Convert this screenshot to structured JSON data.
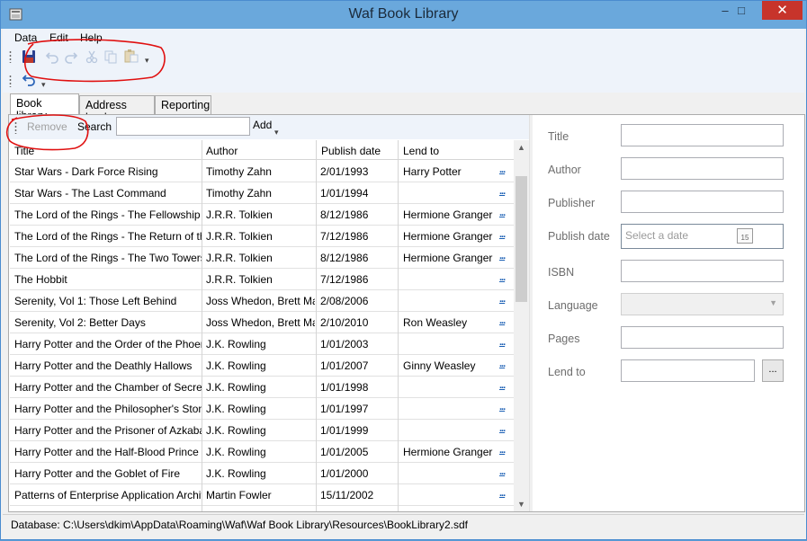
{
  "window": {
    "title": "Waf Book Library",
    "minimize": "–",
    "maximize": "□",
    "close": "✕"
  },
  "menu": [
    "Data",
    "Edit",
    "Help"
  ],
  "toolbar": {
    "icons": [
      "save-icon",
      "undo-icon",
      "redo-icon",
      "cut-icon",
      "copy-icon",
      "paste-icon"
    ],
    "overflow": "▾",
    "undo_overflow": "▾"
  },
  "tabs": [
    "Book library",
    "Address book",
    "Reporting"
  ],
  "list_toolbar": {
    "remove": "Remove",
    "search": "Search",
    "search_value": "",
    "add": "Add",
    "overflow": "▾"
  },
  "grid": {
    "columns": [
      "Title",
      "Author",
      "Publish date",
      "Lend to"
    ],
    "rows": [
      [
        "Star Wars - Dark Force Rising",
        "Timothy Zahn",
        "2/01/1993",
        "Harry Potter"
      ],
      [
        "Star Wars - The Last Command",
        "Timothy Zahn",
        "1/01/1994",
        ""
      ],
      [
        "The Lord of the Rings - The Fellowship",
        "J.R.R. Tolkien",
        "8/12/1986",
        "Hermione Granger"
      ],
      [
        "The Lord of the Rings - The Return of the King",
        "J.R.R. Tolkien",
        "7/12/1986",
        "Hermione Granger"
      ],
      [
        "The Lord of the Rings - The Two Towers",
        "J.R.R. Tolkien",
        "8/12/1986",
        "Hermione Granger"
      ],
      [
        "The Hobbit",
        "J.R.R. Tolkien",
        "7/12/1986",
        ""
      ],
      [
        "Serenity, Vol 1: Those Left Behind",
        "Joss Whedon, Brett Matthews",
        "2/08/2006",
        ""
      ],
      [
        "Serenity, Vol 2: Better Days",
        "Joss Whedon, Brett Matthews",
        "2/10/2010",
        "Ron Weasley"
      ],
      [
        "Harry Potter and the Order of the Phoenix",
        "J.K. Rowling",
        "1/01/2003",
        ""
      ],
      [
        "Harry Potter and the Deathly Hallows",
        "J.K. Rowling",
        "1/01/2007",
        "Ginny Weasley"
      ],
      [
        "Harry Potter and the Chamber of Secrets",
        "J.K. Rowling",
        "1/01/1998",
        ""
      ],
      [
        "Harry Potter and the Philosopher's Stone",
        "J.K. Rowling",
        "1/01/1997",
        ""
      ],
      [
        "Harry Potter and the Prisoner of Azkaban",
        "J.K. Rowling",
        "1/01/1999",
        ""
      ],
      [
        "Harry Potter and the Half-Blood Prince",
        "J.K. Rowling",
        "1/01/2005",
        "Hermione Granger"
      ],
      [
        "Harry Potter and the Goblet of Fire",
        "J.K. Rowling",
        "1/01/2000",
        ""
      ],
      [
        "Patterns of Enterprise Application Architecture",
        "Martin Fowler",
        "15/11/2002",
        ""
      ]
    ],
    "lend_button": "..."
  },
  "details": {
    "fields": [
      {
        "label": "Title",
        "value": ""
      },
      {
        "label": "Author",
        "value": ""
      },
      {
        "label": "Publisher",
        "value": ""
      },
      {
        "label": "Publish date",
        "placeholder": "Select a date"
      },
      {
        "label": "ISBN",
        "value": ""
      },
      {
        "label": "Language",
        "value": ""
      },
      {
        "label": "Pages",
        "value": ""
      },
      {
        "label": "Lend to",
        "value": ""
      }
    ],
    "calendar_day": "15",
    "browse": "..."
  },
  "status": "Database: C:\\Users\\dkim\\AppData\\Roaming\\Waf\\Waf Book Library\\Resources\\BookLibrary2.sdf"
}
